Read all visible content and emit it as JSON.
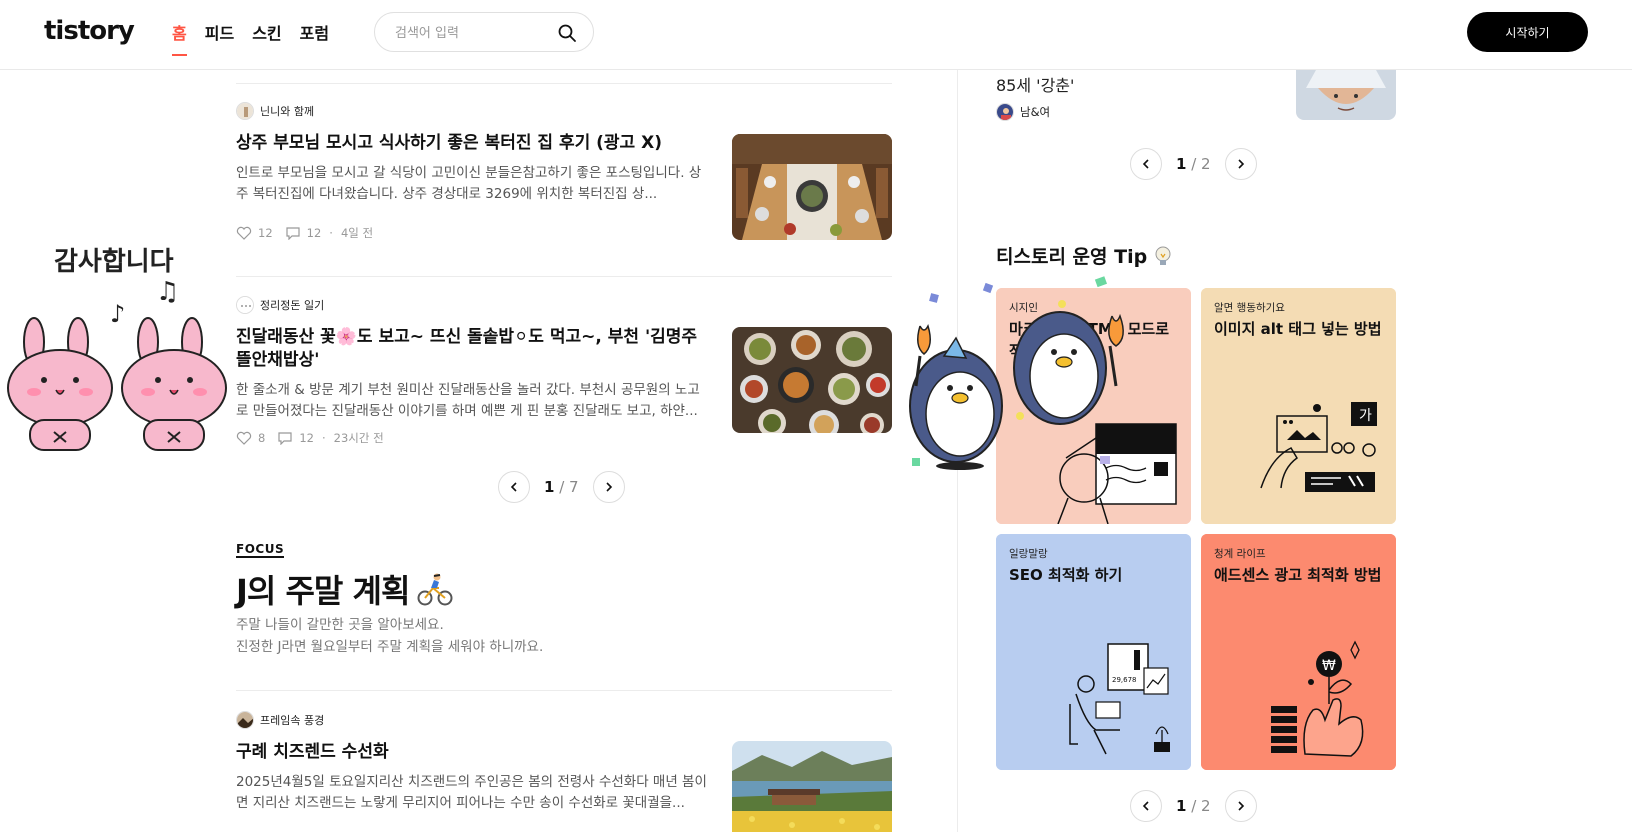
{
  "header": {
    "logo": "tistory",
    "nav": [
      {
        "label": "홈",
        "active": true
      },
      {
        "label": "피드",
        "active": false
      },
      {
        "label": "스킨",
        "active": false
      },
      {
        "label": "포럼",
        "active": false
      }
    ],
    "search_placeholder": "검색어 입력",
    "start_button": "시작하기"
  },
  "posts": [
    {
      "author": "닌니와 함께",
      "title": "상주 부모님 모시고 식사하기 좋은 복터진 집 후기 (광고 X)",
      "excerpt": "인트로 부모님을 모시고 갈 식당이 고민이신 분들은참고하기 좋은 포스팅입니다. 상주 복터진집에 다녀왔습니다. 상주 경상대로 3269에 위치한 복터진집 상...",
      "likes": "12",
      "comments": "12",
      "time": "4일 전"
    },
    {
      "author": "정리정돈 일기",
      "title": "진달래동산 꽃🌸도 보고~ 뜨신 돌솥밥⚪도 먹고~, 부천 '김명주뜰안채밥상'",
      "excerpt": "한 줄소개 & 방문 계기 부천 원미산 진달래동산을 놀러 갔다. 부천시 공무원의 노고로 만들어졌다는 진달래동산 이야기를 하며 예쁜 게 핀 분홍 진달래도 보고, 하얀...",
      "likes": "8",
      "comments": "12",
      "time": "23시간 전"
    }
  ],
  "pager_main": {
    "current": "1",
    "total": "/ 7"
  },
  "focus": {
    "label": "FOCUS",
    "title": "J의 주말 계획",
    "desc_line1": "주말 나들이 갈만한 곳을 알아보세요.",
    "desc_line2": "진정한 J라면 월요일부터 주말 계획을 세워야 하니까요."
  },
  "focus_post": {
    "author": "프레임속 풍경",
    "title": "구례 치즈렌드 수선화",
    "excerpt": "2025년4월5일 토요일지리산 치즈랜드의 주인공은 봄의 전령사 수선화다 매년 봄이면 지리산 치즈랜드는 노랗게 무리지어 피어나는 수만 송이 수선화로 꽃대궐을..."
  },
  "sidebar_prev": {
    "title": "85세 '강춘'",
    "author": "남&여"
  },
  "pager_side_top": {
    "current": "1",
    "total": "/ 2"
  },
  "tips": {
    "heading": "티스토리 운영 Tip",
    "cards": [
      {
        "category": "시지인",
        "title": "마크다운, HTML 모드로 작성하기",
        "color": "#f9cdbd"
      },
      {
        "category": "알면 행동하기요",
        "title": "이미지 alt 태그 넣는 방법",
        "color": "#f4dcb4"
      },
      {
        "category": "일랑말랑",
        "title": "SEO 최적화 하기",
        "color": "#b8cdf0"
      },
      {
        "category": "청계 라이프",
        "title": "애드센스 광고 최적화 방법",
        "color": "#fc8a6f"
      }
    ]
  },
  "pager_side_bottom": {
    "current": "1",
    "total": "/ 2"
  },
  "stickers": {
    "bunny_text": "감사합니다"
  }
}
